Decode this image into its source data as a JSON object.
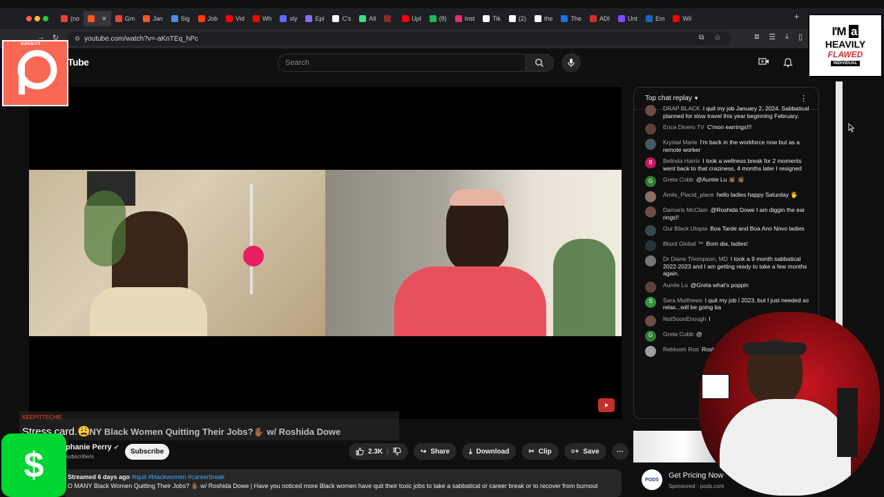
{
  "browser": {
    "tabs": [
      {
        "label": "(no",
        "color": "#ea4335"
      },
      {
        "label": "",
        "color": "#ff5722",
        "active": true
      },
      {
        "label": "Gm",
        "color": "#ea4335"
      },
      {
        "label": "Jan",
        "color": "#ff5722"
      },
      {
        "label": "Sig",
        "color": "#4a90e2"
      },
      {
        "label": "Job",
        "color": "#ff3d00"
      },
      {
        "label": "Vid",
        "color": "#ff0000"
      },
      {
        "label": "Wh",
        "color": "#ff0000"
      },
      {
        "label": "sly",
        "color": "#5b6bff"
      },
      {
        "label": "Epi",
        "color": "#8e6cff"
      },
      {
        "label": "C's",
        "color": "#ffffff"
      },
      {
        "label": "All",
        "color": "#3ddc84"
      },
      {
        "label": "",
        "color": "#8b2c2c"
      },
      {
        "label": "Upl",
        "color": "#ff0000"
      },
      {
        "label": "(8)",
        "color": "#1db954"
      },
      {
        "label": "Inst",
        "color": "#e1306c"
      },
      {
        "label": "Tik",
        "color": "#ffffff"
      },
      {
        "label": "(2)",
        "color": "#ffffff"
      },
      {
        "label": "the",
        "color": "#ffffff"
      },
      {
        "label": "The",
        "color": "#1a73e8"
      },
      {
        "label": "ADI",
        "color": "#d32f2f"
      },
      {
        "label": "Unt",
        "color": "#7c4dff"
      },
      {
        "label": "Em",
        "color": "#1565c0"
      },
      {
        "label": "Wil",
        "color": "#ff0000"
      }
    ],
    "url": "youtube.com/watch?v=-aKnTEq_hPc"
  },
  "youtube": {
    "logo_text": "Tube",
    "search_placeholder": "Search"
  },
  "chat": {
    "header": "Top chat replay",
    "messages": [
      {
        "author": "DRAP BLACK",
        "text": "I quit my job January 2, 2024. Sabbatical planned for slow travel this year beginning February.",
        "avatar_color": "#6d4c41",
        "initial": ""
      },
      {
        "author": "Erica Dinero TV",
        "text": "C'mon earrings!!!",
        "avatar_color": "#5d4037",
        "initial": ""
      },
      {
        "author": "Krystal Marie",
        "text": "I'm back in the workforce now but as a remote worker",
        "avatar_color": "#455a64",
        "initial": ""
      },
      {
        "author": "Belinda Harris",
        "text": "I took a wellness break for 2 moments went back to that craziness, 4 months later I resigned",
        "avatar_color": "#c2185b",
        "initial": "B"
      },
      {
        "author": "Greta Cobb",
        "text": "@Auntie Lu 👏🏾 👏🏾",
        "avatar_color": "#2e7d32",
        "initial": "G"
      },
      {
        "author": "Amils_Placid_place",
        "text": "hello ladies happy Saturday 🖐",
        "avatar_color": "#8d6e63",
        "initial": ""
      },
      {
        "author": "Damaris McClain",
        "text": "@Roshida Dowe I am diggin the ear rings!!",
        "avatar_color": "#6d4c41",
        "initial": ""
      },
      {
        "author": "Our Black Utopia",
        "text": "Boa Tarde and Boa Ano Novo ladies",
        "avatar_color": "#37474f",
        "initial": ""
      },
      {
        "author": "Blaxit Global ™",
        "text": "Bom dia, ladies!",
        "avatar_color": "#263238",
        "initial": ""
      },
      {
        "author": "Dr Diane Thompson, MD",
        "text": "I took a 9 month sabbatical 2022-2023 and I am getting ready to take a few months again.",
        "avatar_color": "#757575",
        "initial": ""
      },
      {
        "author": "Auntie Lu",
        "text": "@Greta what's poppin",
        "avatar_color": "#5d4037",
        "initial": ""
      },
      {
        "author": "Sara Matthews",
        "text": "I quit my job i 2023, but I just needed so relax...will be going ba",
        "avatar_color": "#388e3c",
        "initial": "S"
      },
      {
        "author": "NotSoonEnough",
        "text": "I",
        "avatar_color": "#6d4c41",
        "initial": ""
      },
      {
        "author": "Greta Cobb",
        "text": "@",
        "avatar_color": "#2e7d32",
        "initial": "G"
      },
      {
        "author": "Rebloom Roo",
        "text": "Roshida and",
        "avatar_color": "#9e9e9e",
        "initial": ""
      }
    ]
  },
  "video": {
    "overlay_tag": "KEEPITTECHIE",
    "stress_caption": "Stress card.😩",
    "title": "ANY Black Women Quitting Their Jobs?✋🏾 w/ Roshida Dowe",
    "channel": "phanie Perry",
    "subscribers": "subscribers",
    "subscribe_label": "Subscribe",
    "likes": "2.3K",
    "share_label": "Share",
    "download_label": "Download",
    "clip_label": "Clip",
    "save_label": "Save",
    "description_meta": "Streamed 6 days ago",
    "hashtags": "#iquit #blackwomen #careerbreak",
    "description": "O MANY Black Women Quitting Their Jobs? ✋🏾 w/ Roshida Dowe | Have you noticed more Black women have quit their toxic jobs to take a sabbatical or career break or to recover from burnout"
  },
  "ad": {
    "logo": "PODS",
    "title": "Get Pricing Now",
    "sponsor": "Sponsored · pods.com"
  },
  "overlays": {
    "patreon_tag": "SUPASLY75",
    "flawed_line1": "I'M",
    "flawed_line1b": "a",
    "flawed_line2": "HEAVILY",
    "flawed_line3": "FLAWED",
    "flawed_line4": "INDIVIDUAL",
    "cash_symbol": "$"
  }
}
